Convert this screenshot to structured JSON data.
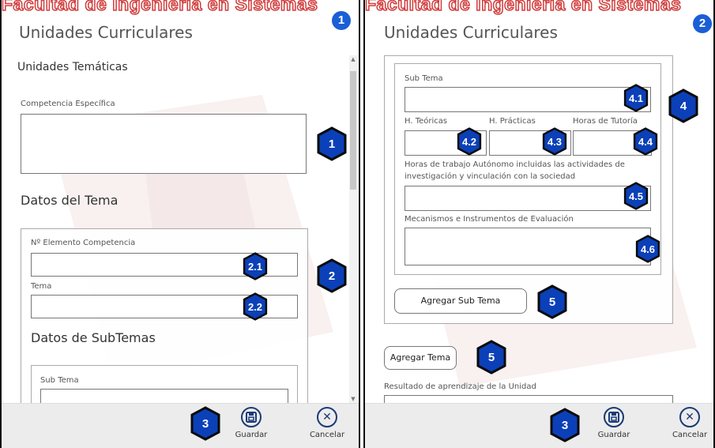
{
  "watermark": "Facultad de Ingeniería en Sistemas",
  "colors": {
    "accent": "#1a5fd6",
    "callout": "#0b40b8",
    "watermark": "#d23c3c",
    "appbar": "#ececec"
  },
  "left": {
    "panel_badge": "1",
    "title": "Unidades Curriculares",
    "section_unidades": "Unidades Temáticas",
    "competencia_label": "Competencia Específica",
    "datos_tema": "Datos del Tema",
    "elemento_label": "Nº Elemento Competencia",
    "tema_label": "Tema",
    "datos_subtemas": "Datos de SubTemas",
    "subtema_label": "Sub Tema",
    "callouts": {
      "c1": "1",
      "c2": "2",
      "c21": "2.1",
      "c22": "2.2",
      "c3": "3"
    },
    "scroll_up_icon": "triangle-up-icon",
    "scroll_down_icon": "triangle-down-icon",
    "guardar_label": "Guardar",
    "cancelar_label": "Cancelar",
    "save_icon": "floppy-disk-icon",
    "cancel_icon": "close-icon"
  },
  "right": {
    "panel_badge": "2",
    "title": "Unidades Curriculares",
    "subtema_label": "Sub Tema",
    "teoricas_label": "H. Teóricas",
    "practicas_label": "H. Prácticas",
    "tutoria_label": "Horas de Tutoría",
    "autonomo_label_1": "Horas de trabajo Autónomo incluidas las actividades de",
    "autonomo_label_2": "investigación y vinculación con la sociedad",
    "mecanismos_label": "Mecanismos e Instrumentos de Evaluación",
    "agregar_subtema": "Agregar Sub Tema",
    "agregar_tema": "Agregar Tema",
    "resultado_label": "Resultado de aprendizaje de la Unidad",
    "callouts": {
      "c4": "4",
      "c41": "4.1",
      "c42": "4.2",
      "c43": "4.3",
      "c44": "4.4",
      "c45": "4.5",
      "c46": "4.6",
      "c5a": "5",
      "c5b": "5",
      "c3": "3"
    },
    "guardar_label": "Guardar",
    "cancelar_label": "Cancelar",
    "save_icon": "floppy-disk-icon",
    "cancel_icon": "close-icon"
  }
}
